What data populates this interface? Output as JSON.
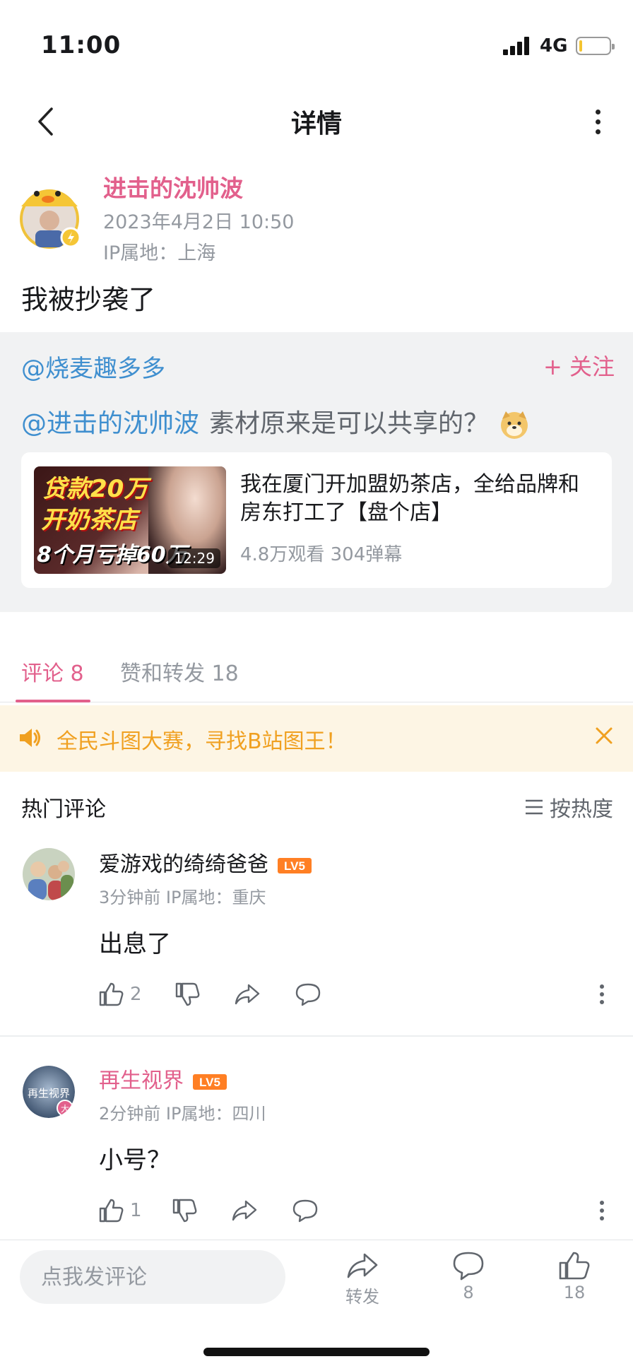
{
  "status_bar": {
    "time": "11:00",
    "network": "4G",
    "battery_level": 0.1
  },
  "nav": {
    "title": "详情"
  },
  "post": {
    "author": "进击的沈帅波",
    "timestamp": "2023年4月2日 10:50",
    "ip": "IP属地：上海",
    "text": "我被抄袭了"
  },
  "repost": {
    "author": "@烧麦趣多多",
    "follow_label": "+ 关注",
    "mention": "@进击的沈帅波",
    "text": "素材原来是可以共享的？",
    "video": {
      "thumb_line1": "贷款20万",
      "thumb_line2": "开奶茶店",
      "thumb_line3": "8个月亏掉60万",
      "duration": "12:29",
      "title": "我在厦门开加盟奶茶店，全给品牌和房东打工了【盘个店】",
      "stats": "4.8万观看 304弹幕"
    }
  },
  "tabs": [
    {
      "label": "评论 8",
      "active": true
    },
    {
      "label": "赞和转发 18",
      "active": false
    }
  ],
  "notice": {
    "text": "全民斗图大赛，寻找B站图王！"
  },
  "comments_header": {
    "title": "热门评论",
    "sort_label": "按热度"
  },
  "comments": [
    {
      "name": "爱游戏的绮绮爸爸",
      "level": "LV5",
      "meta": "3分钟前  IP属地：重庆",
      "text": "出息了",
      "likes": "2",
      "name_color": "#18191c"
    },
    {
      "name": "再生视界",
      "level": "LV5",
      "avatar_text": "再生视界",
      "meta": "2分钟前  IP属地：四川",
      "text": "小号？",
      "likes": "1",
      "name_color": "#e2608c"
    }
  ],
  "bottom_bar": {
    "input_placeholder": "点我发评论",
    "share_label": "转发",
    "comment_count": "8",
    "like_count": "18"
  },
  "colors": {
    "accent_pink": "#e2608c",
    "link_blue": "#3f8fcf",
    "notice_orange": "#f0a020",
    "muted": "#9499a0"
  }
}
